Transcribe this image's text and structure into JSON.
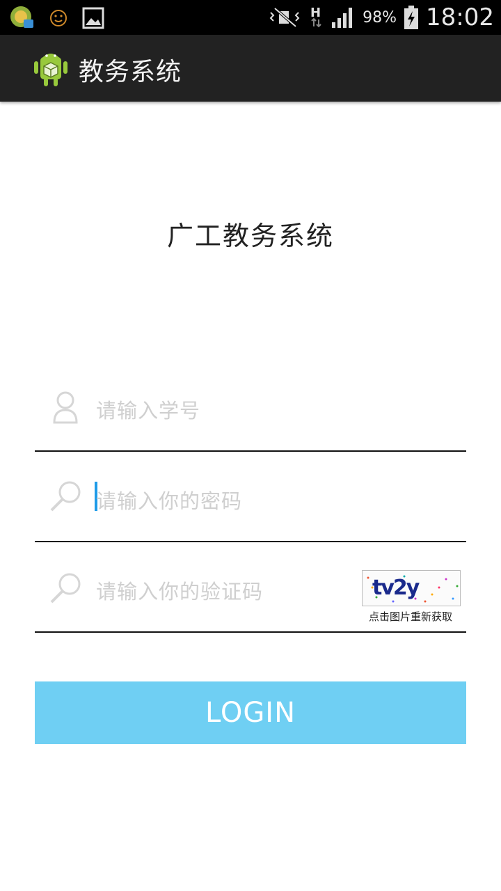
{
  "status_bar": {
    "battery_percent": "98%",
    "time": "18:02",
    "network_type": "H",
    "icons": [
      "app-notification-icon",
      "smiley-icon",
      "image-icon",
      "mute-icon",
      "data-h-icon",
      "signal-icon",
      "battery-charging-icon"
    ]
  },
  "action_bar": {
    "title": "教务系统",
    "background_color": "#222222"
  },
  "main": {
    "heading": "广工教务系统",
    "username_field": {
      "placeholder": "请输入学号",
      "value": ""
    },
    "password_field": {
      "placeholder": "请输入你的密码",
      "value": ""
    },
    "captcha_field": {
      "placeholder": "请输入你的验证码",
      "value": ""
    },
    "captcha_image_text": "tv2y",
    "captcha_hint": "点击图片重新获取",
    "login_button": {
      "label": "LOGIN",
      "color": "#6fcff3"
    }
  }
}
